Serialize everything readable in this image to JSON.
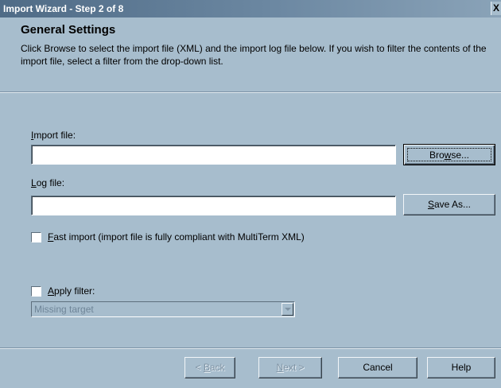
{
  "window": {
    "title": "Import Wizard - Step 2 of 8",
    "close_label": "X"
  },
  "header": {
    "title": "General Settings",
    "description": "Click Browse to select the import file (XML) and the import log file below. If you wish to filter the contents of the import file, select a filter from the drop-down list."
  },
  "import_file": {
    "label_accel": "I",
    "label_rest": "mport file:",
    "value": "",
    "button_pre": "Bro",
    "button_accel": "w",
    "button_post": "se..."
  },
  "log_file": {
    "label_accel": "L",
    "label_rest": "og file:",
    "value": "",
    "button_accel": "S",
    "button_rest": "ave As..."
  },
  "fast_import": {
    "checked": false,
    "label_accel": "F",
    "label_rest": "ast import (import file is fully compliant with MultiTerm XML)"
  },
  "apply_filter": {
    "checked": false,
    "label_accel": "A",
    "label_rest": "pply filter:"
  },
  "filter_select": {
    "selected": "Missing target",
    "enabled": false
  },
  "footer": {
    "back_pre": "< ",
    "back_accel": "B",
    "back_post": "ack",
    "next_accel": "N",
    "next_post": "ext >",
    "cancel": "Cancel",
    "help": "Help"
  }
}
